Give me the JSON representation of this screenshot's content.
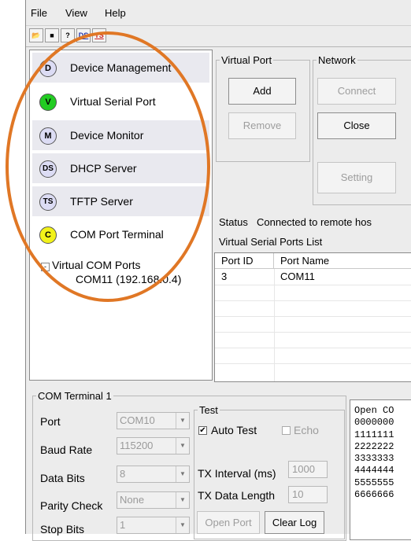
{
  "menu": {
    "file": "File",
    "view": "View",
    "help": "Help"
  },
  "toolbar": {
    "ds": "DS",
    "ts": "TS"
  },
  "sidebar": {
    "items": [
      {
        "icon": "D",
        "label": "Device Management",
        "color": "#dcdcf4"
      },
      {
        "icon": "V",
        "label": "Virtual Serial Port",
        "color": "#22cc22"
      },
      {
        "icon": "M",
        "label": "Device Monitor",
        "color": "#dcdcf4"
      },
      {
        "icon": "DS",
        "label": "DHCP Server",
        "color": "#dcdcf4"
      },
      {
        "icon": "TS",
        "label": "TFTP Server",
        "color": "#dcdcf4"
      },
      {
        "icon": "C",
        "label": "COM Port Terminal",
        "color": "#f2f21a"
      }
    ],
    "tree_root": "Virtual COM Ports",
    "tree_child": "COM11 (192.168.0.4)"
  },
  "virtual_port": {
    "legend": "Virtual Port",
    "add": "Add",
    "remove": "Remove"
  },
  "network": {
    "legend": "Network",
    "connect": "Connect",
    "close": "Close",
    "setting": "Setting"
  },
  "status": {
    "label": "Status",
    "value": "Connected to remote hos"
  },
  "list": {
    "title": "Virtual Serial Ports List",
    "columns": [
      "Port ID",
      "Port Name"
    ],
    "rows": [
      {
        "id": "3",
        "name": "COM11"
      }
    ]
  },
  "terminal": {
    "legend": "COM Terminal 1",
    "port_label": "Port",
    "port_value": "COM10",
    "baud_label": "Baud Rate",
    "baud_value": "115200",
    "databits_label": "Data Bits",
    "databits_value": "8",
    "parity_label": "Parity Check",
    "parity_value": "None",
    "stopbits_label": "Stop Bits",
    "stopbits_value": "1"
  },
  "test": {
    "legend": "Test",
    "auto_test": "Auto Test",
    "echo": "Echo",
    "tx_interval_label": "TX Interval (ms)",
    "tx_interval_value": "1000",
    "tx_length_label": "TX Data Length",
    "tx_length_value": "10",
    "open_port": "Open Port",
    "clear_log": "Clear Log"
  },
  "log": {
    "lines": [
      "Open CO",
      "0000000",
      "1111111",
      "2222222",
      "3333333",
      "4444444",
      "5555555",
      "6666666"
    ]
  }
}
